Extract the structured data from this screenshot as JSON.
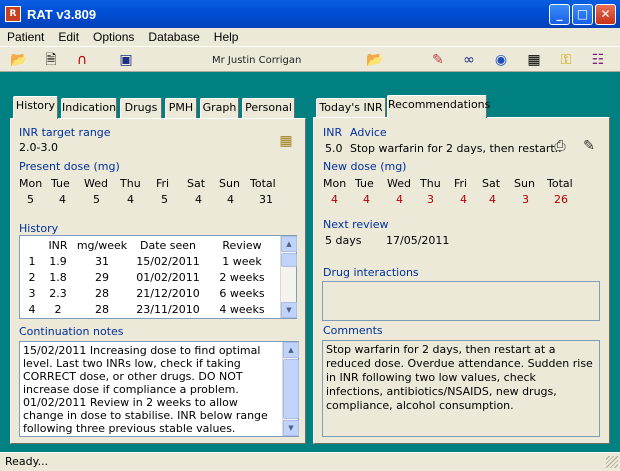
{
  "window": {
    "title": "RAT v3.809",
    "app_icon": "R",
    "min": "_",
    "max": "□",
    "close": "✕"
  },
  "menu": [
    "Patient",
    "Edit",
    "Options",
    "Database",
    "Help"
  ],
  "toolbar": {
    "patient_name": "Mr Justin Corrigan",
    "icons": [
      "open-folder-icon",
      "new-document-icon",
      "magnet-icon",
      "save-icon",
      "import-folder-icon",
      "notepad-icon",
      "glasses-icon",
      "pills-icon",
      "calculator-icon",
      "key-icon",
      "book-icon"
    ]
  },
  "left_tabs": [
    "History",
    "Indication",
    "Drugs",
    "PMH",
    "Graph",
    "Personal"
  ],
  "right_tabs": [
    "Today's INR",
    "Recommendations"
  ],
  "history": {
    "inr_target_label": "INR target range",
    "inr_target_value": "2.0-3.0",
    "present_dose_label": "Present dose (mg)",
    "days": [
      "Mon",
      "Tue",
      "Wed",
      "Thu",
      "Fri",
      "Sat",
      "Sun",
      "Total"
    ],
    "present_dose": [
      "5",
      "4",
      "5",
      "4",
      "5",
      "4",
      "4",
      "31"
    ],
    "history_label": "History",
    "table_headers": [
      "",
      "INR",
      "mg/week",
      "Date seen",
      "Review"
    ],
    "table_rows": [
      [
        "1",
        "1.9",
        "31",
        "15/02/2011",
        "1 week"
      ],
      [
        "2",
        "1.8",
        "29",
        "01/02/2011",
        "2 weeks"
      ],
      [
        "3",
        "2.3",
        "28",
        "21/12/2010",
        "6 weeks"
      ],
      [
        "4",
        "2",
        "28",
        "23/11/2010",
        "4 weeks"
      ]
    ],
    "notes_label": "Continuation notes",
    "notes": "15/02/2011 Increasing dose to find optimal level. Last two INRs low, check if taking CORRECT dose, or other drugs. DO NOT increase dose if compliance a problem.\n01/02/2011 Review in 2 weeks to allow change in dose to stabilise. INR below range following three previous stable values. BEFORE increasing dose,"
  },
  "recommendations": {
    "inr_label": "INR",
    "advice_label": "Advice",
    "inr_value": "5.0",
    "advice": "Stop warfarin for 2 days, then restart..",
    "new_dose_label": "New dose (mg)",
    "new_dose": [
      "4",
      "4",
      "4",
      "3",
      "4",
      "4",
      "3",
      "26"
    ],
    "next_review_label": "Next review",
    "next_review_interval": "5 days",
    "next_review_date": "17/05/2011",
    "drug_interactions_label": "Drug interactions",
    "drug_interactions": "",
    "comments_label": "Comments",
    "comments": "Stop warfarin for 2 days, then restart at a reduced dose. Overdue attendance. Sudden rise in INR following two low values, check infections, antibiotics/NSAIDS, new drugs, compliance, alcohol consumption."
  },
  "status": "Ready..."
}
